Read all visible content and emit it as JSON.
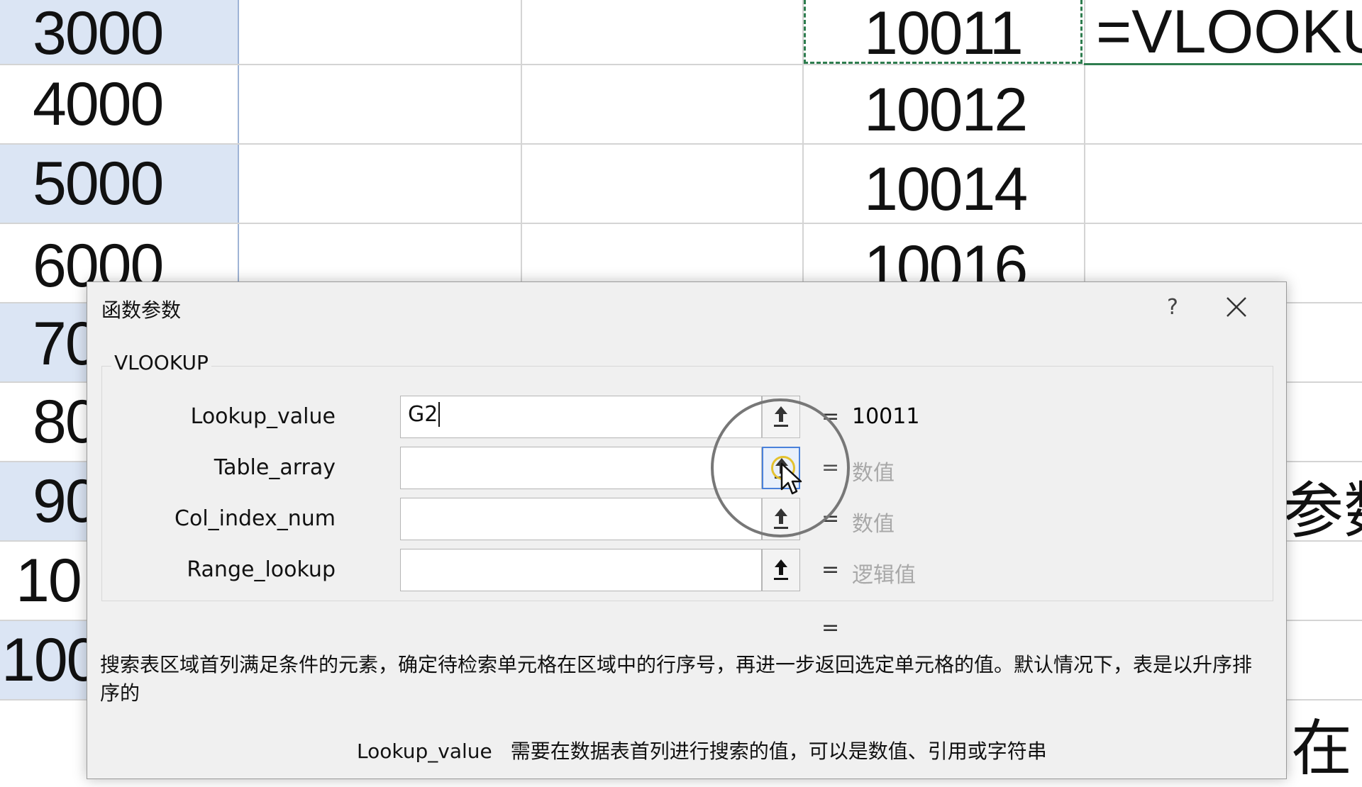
{
  "spreadsheet": {
    "column_a_values": [
      "3000",
      "4000",
      "5000",
      "6000",
      "70",
      "80",
      "90",
      "10",
      "100"
    ],
    "column_e_values": [
      "10011",
      "10012",
      "10014",
      "10016"
    ],
    "formula_cell_text": "=VLOOKU",
    "right_edge_text_1": "参数",
    "right_edge_text_2": "在"
  },
  "dialog": {
    "title": "函数参数",
    "help_label": "?",
    "function_name": "VLOOKUP",
    "arguments": [
      {
        "label": "Lookup_value",
        "value": "G2",
        "equals": "=",
        "result": "10011"
      },
      {
        "label": "Table_array",
        "value": "",
        "equals": "=",
        "result": "数值"
      },
      {
        "label": "Col_index_num",
        "value": "",
        "equals": "=",
        "result": "数值"
      },
      {
        "label": "Range_lookup",
        "value": "",
        "equals": "=",
        "result": "逻辑值"
      }
    ],
    "formula_result_equals": "=",
    "description": "搜索表区域首列满足条件的元素，确定待检索单元格在区域中的行序号，再进一步返回选定单元格的值。默认情况下，表是以升序排序的",
    "param_help_name": "Lookup_value",
    "param_help_text": "需要在数据表首列进行搜索的值，可以是数值、引用或字符串"
  },
  "colors": {
    "selected_header_fill": "#dbe5f4",
    "copy_marquee": "#2e7d4f",
    "dialog_bg": "#f0f0f0",
    "placeholder_gray": "#a8a8a8"
  },
  "icons": [
    "collapse-dialog-icon",
    "close-icon",
    "mouse-pointer-icon"
  ]
}
